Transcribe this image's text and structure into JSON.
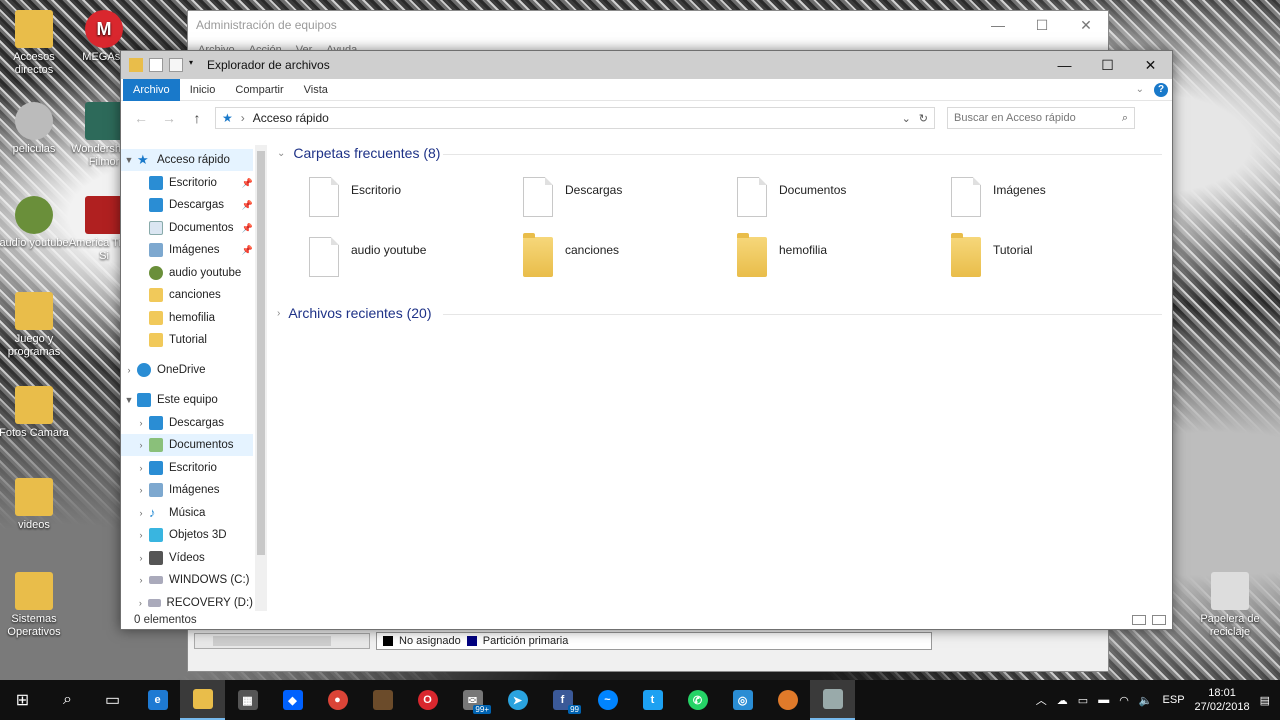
{
  "desktop_icons": [
    {
      "label": "Accesos directos",
      "icon": "folder-icon",
      "color": "#e9bd4a"
    },
    {
      "label": "MEGAsy",
      "icon": "mega-icon",
      "color": "#d9272e"
    },
    {
      "label": "peliculas",
      "icon": "dvd-icon",
      "color": "#bbbbbb"
    },
    {
      "label": "Wondershare Filmor",
      "icon": "filmora-icon",
      "color": "#2d6a5a"
    },
    {
      "label": "audio youtube",
      "icon": "media-icon",
      "color": "#6a8f3a"
    },
    {
      "label": "America Truck Si",
      "icon": "truck-game-icon",
      "color": "#b02020"
    },
    {
      "label": "Juego y programas",
      "icon": "folder-icon",
      "color": "#e9bd4a"
    },
    {
      "label": "Fotos Camara",
      "icon": "folder-icon",
      "color": "#e9bd4a"
    },
    {
      "label": "videos",
      "icon": "folder-icon",
      "color": "#e9bd4a"
    },
    {
      "label": "Sistemas Operativos",
      "icon": "folder-icon",
      "color": "#e9bd4a"
    },
    {
      "label": "Papelera de reciclaje",
      "icon": "recycle-bin-icon",
      "color": "#dddddd"
    }
  ],
  "bg_window": {
    "title": "Administración de equipos",
    "menu": [
      "Archivo",
      "Acción",
      "Ver",
      "Ayuda"
    ],
    "legend": [
      {
        "label": "No asignado",
        "color": "#000000"
      },
      {
        "label": "Partición primaria",
        "color": "#000080"
      }
    ]
  },
  "explorer": {
    "title": "Explorador de archivos",
    "ribbon_tabs": [
      "Archivo",
      "Inicio",
      "Compartir",
      "Vista"
    ],
    "address": "Acceso rápido",
    "search_placeholder": "Buscar en Acceso rápido",
    "nav": {
      "quick_access": "Acceso rápido",
      "quick_items": [
        "Escritorio",
        "Descargas",
        "Documentos",
        "Imágenes",
        "audio youtube",
        "canciones",
        "hemofilia",
        "Tutorial"
      ],
      "onedrive": "OneDrive",
      "this_pc": "Este equipo",
      "pc_items": [
        "Descargas",
        "Documentos",
        "Escritorio",
        "Imágenes",
        "Música",
        "Objetos 3D",
        "Vídeos",
        "WINDOWS (C:)",
        "RECOVERY (D:)"
      ]
    },
    "frequent_header": "Carpetas frecuentes (8)",
    "frequent": [
      {
        "label": "Escritorio",
        "kind": "file"
      },
      {
        "label": "Descargas",
        "kind": "file"
      },
      {
        "label": "Documentos",
        "kind": "file"
      },
      {
        "label": "Imágenes",
        "kind": "file"
      },
      {
        "label": "audio youtube",
        "kind": "file"
      },
      {
        "label": "canciones",
        "kind": "folder"
      },
      {
        "label": "hemofilia",
        "kind": "folder"
      },
      {
        "label": "Tutorial",
        "kind": "folder"
      }
    ],
    "recent_header": "Archivos recientes (20)",
    "status": "0 elementos"
  },
  "taskbar": {
    "badges": {
      "mail": "99+",
      "facebook": "99"
    },
    "language": "ESP",
    "time": "18:01",
    "date": "27/02/2018"
  }
}
